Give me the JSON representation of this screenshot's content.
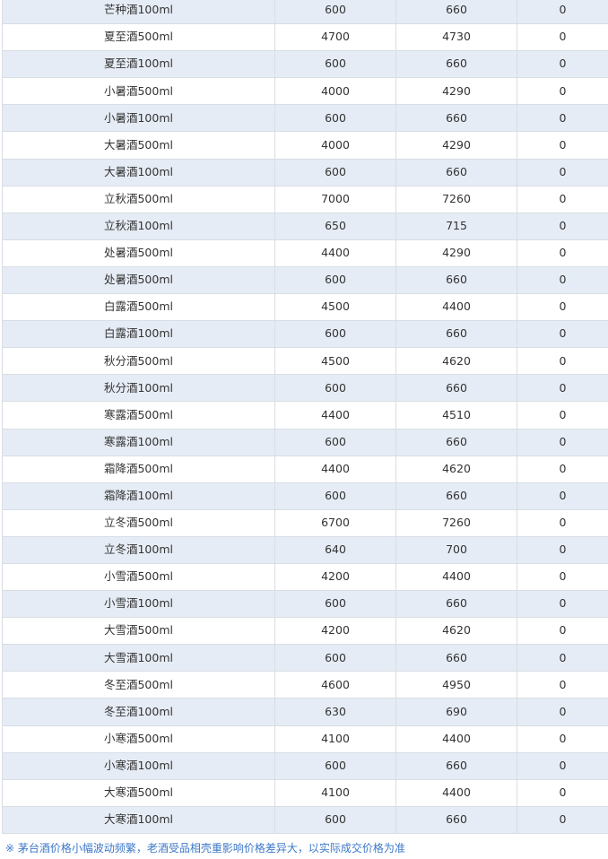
{
  "table": {
    "rows": [
      {
        "name": "芒种酒100ml",
        "col2": "600",
        "col3": "660",
        "col4": "0"
      },
      {
        "name": "夏至酒500ml",
        "col2": "4700",
        "col3": "4730",
        "col4": "0"
      },
      {
        "name": "夏至酒100ml",
        "col2": "600",
        "col3": "660",
        "col4": "0"
      },
      {
        "name": "小暑酒500ml",
        "col2": "4000",
        "col3": "4290",
        "col4": "0"
      },
      {
        "name": "小暑酒100ml",
        "col2": "600",
        "col3": "660",
        "col4": "0"
      },
      {
        "name": "大暑酒500ml",
        "col2": "4000",
        "col3": "4290",
        "col4": "0"
      },
      {
        "name": "大暑酒100ml",
        "col2": "600",
        "col3": "660",
        "col4": "0"
      },
      {
        "name": "立秋酒500ml",
        "col2": "7000",
        "col3": "7260",
        "col4": "0"
      },
      {
        "name": "立秋酒100ml",
        "col2": "650",
        "col3": "715",
        "col4": "0"
      },
      {
        "name": "处暑酒500ml",
        "col2": "4400",
        "col3": "4290",
        "col4": "0"
      },
      {
        "name": "处暑酒500ml",
        "col2": "600",
        "col3": "660",
        "col4": "0"
      },
      {
        "name": "白露酒500ml",
        "col2": "4500",
        "col3": "4400",
        "col4": "0"
      },
      {
        "name": "白露酒100ml",
        "col2": "600",
        "col3": "660",
        "col4": "0"
      },
      {
        "name": "秋分酒500ml",
        "col2": "4500",
        "col3": "4620",
        "col4": "0"
      },
      {
        "name": "秋分酒100ml",
        "col2": "600",
        "col3": "660",
        "col4": "0"
      },
      {
        "name": "寒露酒500ml",
        "col2": "4400",
        "col3": "4510",
        "col4": "0"
      },
      {
        "name": "寒露酒100ml",
        "col2": "600",
        "col3": "660",
        "col4": "0"
      },
      {
        "name": "霜降酒500ml",
        "col2": "4400",
        "col3": "4620",
        "col4": "0"
      },
      {
        "name": "霜降酒100ml",
        "col2": "600",
        "col3": "660",
        "col4": "0"
      },
      {
        "name": "立冬酒500ml",
        "col2": "6700",
        "col3": "7260",
        "col4": "0"
      },
      {
        "name": "立冬酒100ml",
        "col2": "640",
        "col3": "700",
        "col4": "0"
      },
      {
        "name": "小雪酒500ml",
        "col2": "4200",
        "col3": "4400",
        "col4": "0"
      },
      {
        "name": "小雪酒100ml",
        "col2": "600",
        "col3": "660",
        "col4": "0"
      },
      {
        "name": "大雪酒500ml",
        "col2": "4200",
        "col3": "4620",
        "col4": "0"
      },
      {
        "name": "大雪酒100ml",
        "col2": "600",
        "col3": "660",
        "col4": "0"
      },
      {
        "name": "冬至酒500ml",
        "col2": "4600",
        "col3": "4950",
        "col4": "0"
      },
      {
        "name": "冬至酒100ml",
        "col2": "630",
        "col3": "690",
        "col4": "0"
      },
      {
        "name": "小寒酒500ml",
        "col2": "4100",
        "col3": "4400",
        "col4": "0"
      },
      {
        "name": "小寒酒100ml",
        "col2": "600",
        "col3": "660",
        "col4": "0"
      },
      {
        "name": "大寒酒500ml",
        "col2": "4100",
        "col3": "4400",
        "col4": "0"
      },
      {
        "name": "大寒酒100ml",
        "col2": "600",
        "col3": "660",
        "col4": "0"
      }
    ]
  },
  "footnote": "※ 茅台酒价格小幅波动频繁，老酒受品相壳重影响价格差异大，以实际成交价格为准",
  "colors": {
    "stripe": "#e6ecf5",
    "border": "#d9dde4",
    "footnote": "#3d78c9"
  }
}
